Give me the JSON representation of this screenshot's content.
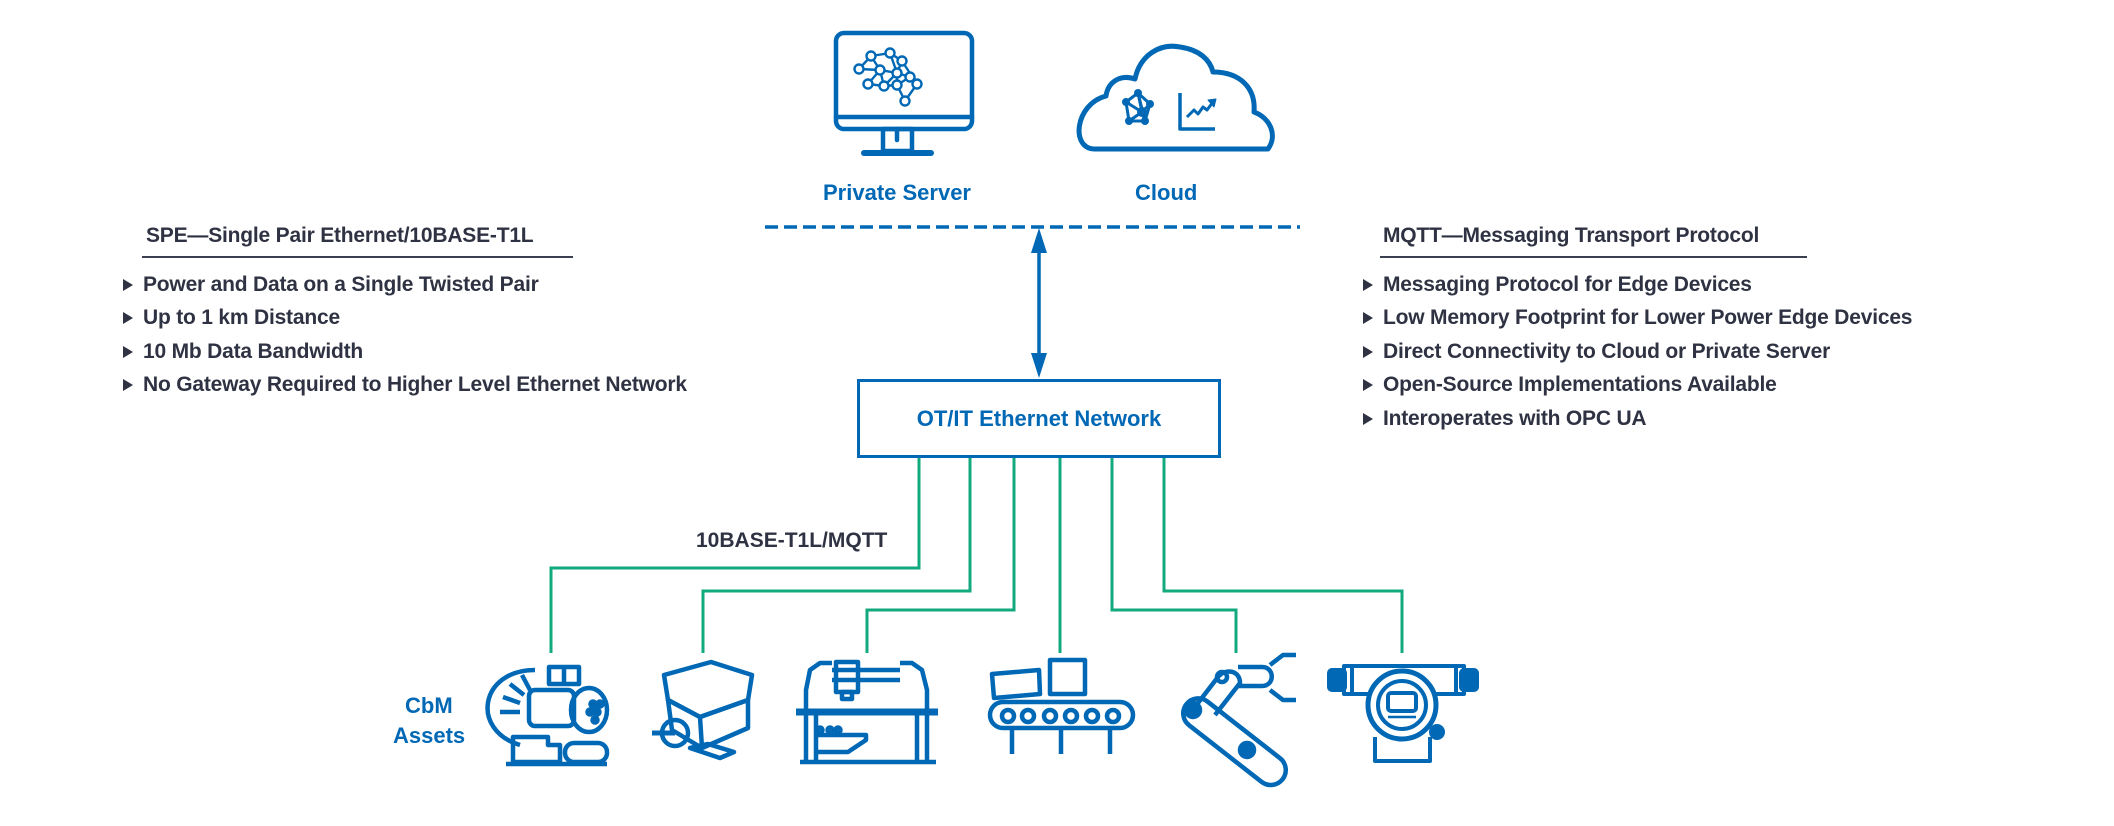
{
  "colors": {
    "brand_blue": "#0068b5",
    "link_green": "#12a97e",
    "text_dark": "#2f3242"
  },
  "top": {
    "private_server": {
      "label": "Private Server",
      "icon": "monitor-neural-network-icon"
    },
    "cloud": {
      "label": "Cloud",
      "icon": "cloud-analytics-icon"
    }
  },
  "network": {
    "label": "OT/IT Ethernet Network",
    "link_label": "10BASE-T1L/MQTT"
  },
  "spe": {
    "heading": "SPE—Single Pair Ethernet/10BASE-T1L",
    "bullets": [
      "Power and Data on a Single Twisted Pair",
      "Up to 1 km Distance",
      "10 Mb Data Bandwidth",
      "No Gateway Required to Higher Level Ethernet Network"
    ]
  },
  "mqtt": {
    "heading": "MQTT—Messaging Transport Protocol",
    "bullets": [
      "Messaging Protocol for Edge Devices",
      "Low Memory Footprint for Lower Power Edge Devices",
      "Direct Connectivity to Cloud or Private Server",
      "Open-Source Implementations Available",
      "Interoperates with OPC UA"
    ]
  },
  "assets": {
    "label_line1": "CbM",
    "label_line2": "Assets",
    "items": [
      {
        "name": "turbine",
        "icon": "turbine-icon"
      },
      {
        "name": "electric-motor",
        "icon": "electric-motor-icon"
      },
      {
        "name": "cnc-machine",
        "icon": "cnc-machine-icon"
      },
      {
        "name": "conveyor",
        "icon": "conveyor-belt-icon"
      },
      {
        "name": "robot-arm",
        "icon": "robot-arm-icon"
      },
      {
        "name": "field-transmitter",
        "icon": "pressure-transmitter-icon"
      }
    ]
  }
}
